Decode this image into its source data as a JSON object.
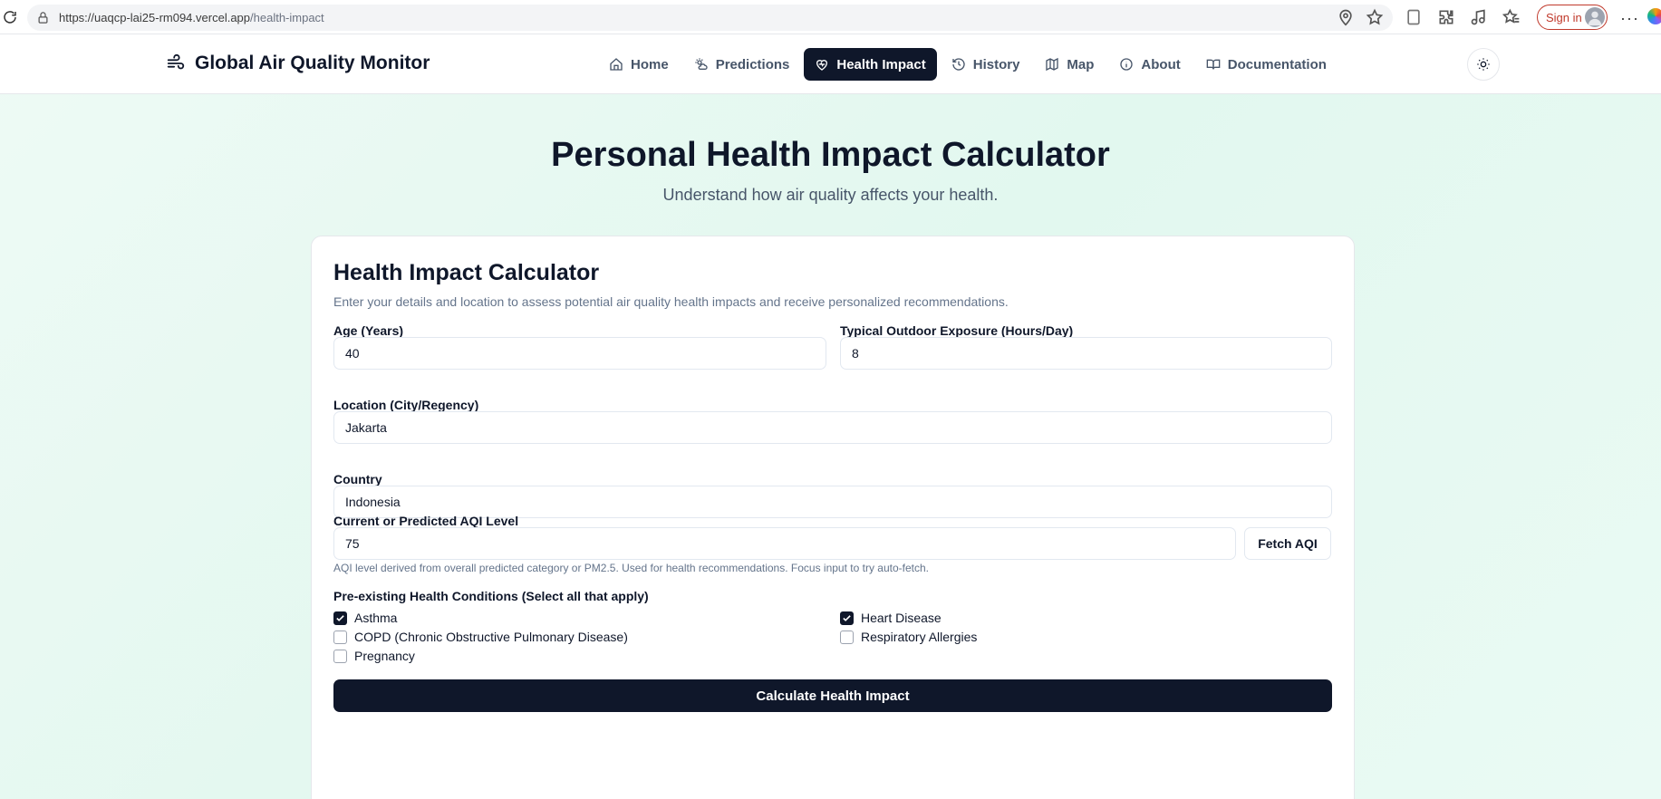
{
  "browser": {
    "url_host": "https://uaqcp-lai25-rm094.vercel.app",
    "url_path": "/health-impact",
    "sign_in_label": "Sign in"
  },
  "nav": {
    "brand": "Global Air Quality Monitor",
    "items": [
      {
        "label": "Home",
        "icon": "home-icon",
        "active": false
      },
      {
        "label": "Predictions",
        "icon": "sun-cloud-icon",
        "active": false
      },
      {
        "label": "Health Impact",
        "icon": "heart-pulse-icon",
        "active": true
      },
      {
        "label": "History",
        "icon": "history-icon",
        "active": false
      },
      {
        "label": "Map",
        "icon": "map-icon",
        "active": false
      },
      {
        "label": "About",
        "icon": "info-icon",
        "active": false
      },
      {
        "label": "Documentation",
        "icon": "book-icon",
        "active": false
      }
    ]
  },
  "hero": {
    "title": "Personal Health Impact Calculator",
    "subtitle": "Understand how air quality affects your health."
  },
  "calculator": {
    "title": "Health Impact Calculator",
    "description": "Enter your details and location to assess potential air quality health impacts and receive personalized recommendations.",
    "age": {
      "label": "Age (Years)",
      "value": "40"
    },
    "exposure": {
      "label": "Typical Outdoor Exposure (Hours/Day)",
      "value": "8"
    },
    "location": {
      "label": "Location (City/Regency)",
      "value": "Jakarta"
    },
    "country": {
      "label": "Country",
      "value": "Indonesia"
    },
    "aqi": {
      "label": "Current or Predicted AQI Level",
      "value": "75",
      "fetch_label": "Fetch AQI",
      "hint": "AQI level derived from overall predicted category or PM2.5. Used for health recommendations. Focus input to try auto-fetch."
    },
    "conditions": {
      "label": "Pre-existing Health Conditions (Select all that apply)",
      "items": [
        {
          "label": "Asthma",
          "checked": true
        },
        {
          "label": "Heart Disease",
          "checked": true
        },
        {
          "label": "COPD (Chronic Obstructive Pulmonary Disease)",
          "checked": false
        },
        {
          "label": "Respiratory Allergies",
          "checked": false
        },
        {
          "label": "Pregnancy",
          "checked": false
        }
      ]
    },
    "submit_label": "Calculate Health Impact"
  },
  "colors": {
    "primary": "#0f172a",
    "muted_text": "#64748b",
    "page_bg": "#e2f8ef"
  }
}
